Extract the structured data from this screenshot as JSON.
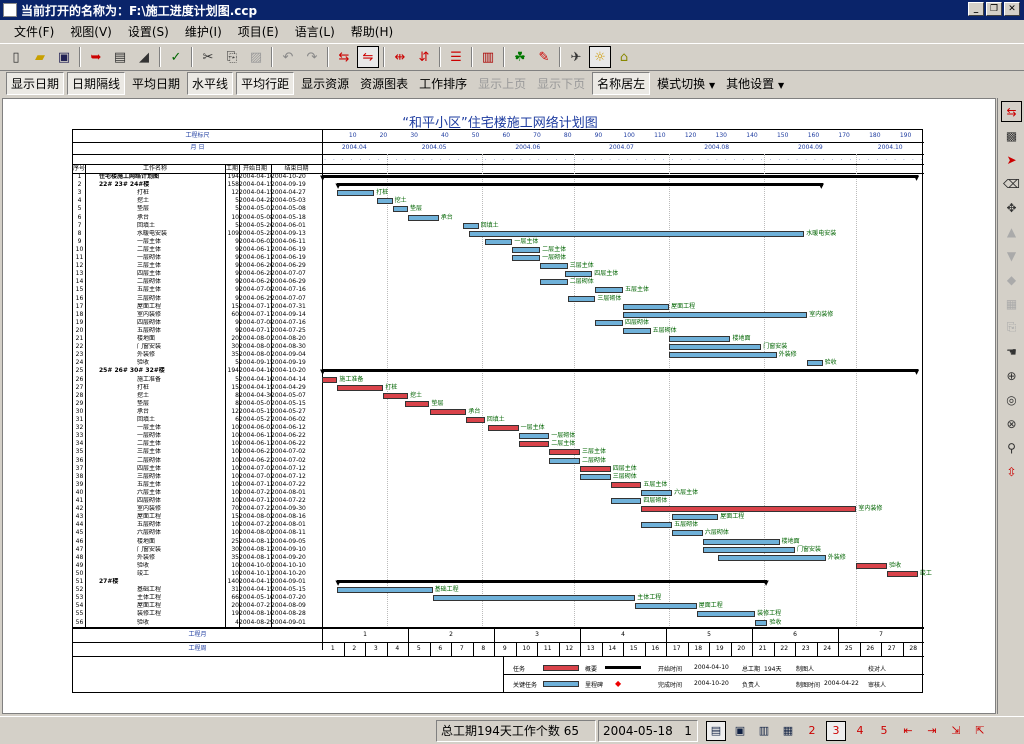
{
  "window": {
    "title": "当前打开的名称为：F:\\施工进度计划图.ccp",
    "buttons": [
      "0",
      "1",
      "r"
    ]
  },
  "menu": [
    "文件(F)",
    "视图(V)",
    "设置(S)",
    "维护(I)",
    "项目(E)",
    "语言(L)",
    "帮助(H)"
  ],
  "toolbar1": {
    "icons": [
      "new-icon",
      "open-icon",
      "save-icon",
      "import-icon",
      "export-icon",
      "fill-icon",
      "check-icon",
      "cut-icon",
      "copy-icon",
      "paste-icon",
      "undo-icon",
      "redo-icon",
      "link-icon",
      "link-active-icon",
      "arrow-left-right-icon",
      "arrow-up-down-icon",
      "align-icon",
      "books-icon",
      "people-icon",
      "pencil-icon",
      "plane-icon",
      "bulb-icon",
      "fold-icon"
    ]
  },
  "toolbar2": [
    {
      "label": "显示日期",
      "state": "pressed"
    },
    {
      "label": "日期隔线",
      "state": "pressed"
    },
    {
      "label": "平均日期",
      "state": "normal"
    },
    {
      "label": "水平线",
      "state": "pressed"
    },
    {
      "label": "平均行距",
      "state": "pressed"
    },
    {
      "label": "显示资源",
      "state": "normal"
    },
    {
      "label": "资源图表",
      "state": "normal"
    },
    {
      "label": "工作排序",
      "state": "normal"
    },
    {
      "label": "显示上页",
      "state": "disabled"
    },
    {
      "label": "显示下页",
      "state": "disabled"
    },
    {
      "label": "名称居左",
      "state": "pressed"
    },
    {
      "label": "模式切换",
      "state": "dropdown"
    },
    {
      "label": "其他设置",
      "state": "dropdown"
    }
  ],
  "chart": {
    "title": "“和平小区”住宅楼施工网络计划图",
    "hdr_work_scale": "工程标尺",
    "hdr_month": "月 日",
    "col_headers": [
      "序号",
      "工作名称",
      "工期",
      "开始日期",
      "结束日期"
    ],
    "scale_ticks": [
      "10",
      "20",
      "30",
      "40",
      "50",
      "60",
      "70",
      "80",
      "90",
      "100",
      "110",
      "120",
      "130",
      "140",
      "150",
      "160",
      "170",
      "180",
      "190"
    ],
    "months": [
      "2004.04",
      "2004.05",
      "2004.06",
      "2004.07",
      "2004.08",
      "2004.09",
      "2004.10"
    ],
    "bottom_week_label": "工程月",
    "bottom_week": [
      "1",
      "2",
      "3",
      "4",
      "5",
      "6",
      "7"
    ],
    "bottom_weeknum_label": "工程周",
    "bottom_weeknums": [
      "1",
      "2",
      "3",
      "4",
      "5",
      "6",
      "7",
      "8",
      "9",
      "10",
      "11",
      "12",
      "13",
      "14",
      "15",
      "16",
      "17",
      "18",
      "19",
      "20",
      "21",
      "22",
      "23",
      "24",
      "25",
      "26",
      "27",
      "28"
    ],
    "tasks": [
      {
        "n": "1",
        "name": "住宅楼施工网络计划图",
        "d": "194",
        "s": "2004-04-10",
        "e": "2004-10-20",
        "type": "sum",
        "b": 0,
        "l": 194,
        "label": ""
      },
      {
        "n": "2",
        "name": "22# 23# 24#楼",
        "d": "158",
        "s": "2004-04-15",
        "e": "2004-09-19",
        "type": "sum",
        "b": 5,
        "l": 158,
        "label": ""
      },
      {
        "n": "3",
        "name": "打桩",
        "d": "12",
        "s": "2004-04-15",
        "e": "2004-04-27",
        "type": "blue",
        "b": 5,
        "l": 12,
        "label": "打桩"
      },
      {
        "n": "4",
        "name": "挖土",
        "d": "5",
        "s": "2004-04-28",
        "e": "2004-05-03",
        "type": "blue",
        "b": 18,
        "l": 5,
        "label": "挖土"
      },
      {
        "n": "5",
        "name": "垫层",
        "d": "5",
        "s": "2004-05-03",
        "e": "2004-05-08",
        "type": "blue",
        "b": 23,
        "l": 5,
        "label": "垫层"
      },
      {
        "n": "6",
        "name": "承台",
        "d": "10",
        "s": "2004-05-08",
        "e": "2004-05-18",
        "type": "blue",
        "b": 28,
        "l": 10,
        "label": "承台"
      },
      {
        "n": "7",
        "name": "回填土",
        "d": "5",
        "s": "2004-05-26",
        "e": "2004-06-01",
        "type": "blue",
        "b": 46,
        "l": 5,
        "label": "回填土"
      },
      {
        "n": "8",
        "name": "水暖电安装",
        "d": "109",
        "s": "2004-05-28",
        "e": "2004-09-13",
        "type": "blue",
        "b": 48,
        "l": 109,
        "label": "水暖电安装"
      },
      {
        "n": "9",
        "name": "一层主体",
        "d": "9",
        "s": "2004-06-02",
        "e": "2004-06-11",
        "type": "blue",
        "b": 53,
        "l": 9,
        "label": "一层主体"
      },
      {
        "n": "10",
        "name": "二层主体",
        "d": "9",
        "s": "2004-06-11",
        "e": "2004-06-19",
        "type": "blue",
        "b": 62,
        "l": 9,
        "label": "二层主体"
      },
      {
        "n": "11",
        "name": "一层砌体",
        "d": "9",
        "s": "2004-06-11",
        "e": "2004-06-19",
        "type": "blue",
        "b": 62,
        "l": 9,
        "label": "一层砌体"
      },
      {
        "n": "12",
        "name": "三层主体",
        "d": "9",
        "s": "2004-06-20",
        "e": "2004-06-29",
        "type": "blue",
        "b": 71,
        "l": 9,
        "label": "三层主体"
      },
      {
        "n": "13",
        "name": "四层主体",
        "d": "9",
        "s": "2004-06-28",
        "e": "2004-07-07",
        "type": "blue",
        "b": 79,
        "l": 9,
        "label": "四层主体"
      },
      {
        "n": "14",
        "name": "二层砌体",
        "d": "9",
        "s": "2004-06-20",
        "e": "2004-06-29",
        "type": "blue",
        "b": 71,
        "l": 9,
        "label": "二层砌体"
      },
      {
        "n": "15",
        "name": "五层主体",
        "d": "9",
        "s": "2004-07-08",
        "e": "2004-07-16",
        "type": "blue",
        "b": 89,
        "l": 9,
        "label": "五层主体"
      },
      {
        "n": "16",
        "name": "三层砌体",
        "d": "9",
        "s": "2004-06-29",
        "e": "2004-07-07",
        "type": "blue",
        "b": 80,
        "l": 9,
        "label": "三层砌体"
      },
      {
        "n": "17",
        "name": "屋面工程",
        "d": "15",
        "s": "2004-07-17",
        "e": "2004-07-31",
        "type": "blue",
        "b": 98,
        "l": 15,
        "label": "屋面工程"
      },
      {
        "n": "18",
        "name": "室内装修",
        "d": "60",
        "s": "2004-07-17",
        "e": "2004-09-14",
        "type": "blue",
        "b": 98,
        "l": 60,
        "label": "室内装修"
      },
      {
        "n": "19",
        "name": "四层砌体",
        "d": "9",
        "s": "2004-07-08",
        "e": "2004-07-16",
        "type": "blue",
        "b": 89,
        "l": 9,
        "label": "四层砌体"
      },
      {
        "n": "20",
        "name": "五层砌体",
        "d": "9",
        "s": "2004-07-17",
        "e": "2004-07-25",
        "type": "blue",
        "b": 98,
        "l": 9,
        "label": "五层砌体"
      },
      {
        "n": "21",
        "name": "楼地面",
        "d": "20",
        "s": "2004-08-01",
        "e": "2004-08-20",
        "type": "blue",
        "b": 113,
        "l": 20,
        "label": "楼地面"
      },
      {
        "n": "22",
        "name": "门窗安装",
        "d": "30",
        "s": "2004-08-01",
        "e": "2004-08-30",
        "type": "blue",
        "b": 113,
        "l": 30,
        "label": "门窗安装"
      },
      {
        "n": "23",
        "name": "外装修",
        "d": "35",
        "s": "2004-08-01",
        "e": "2004-09-04",
        "type": "blue",
        "b": 113,
        "l": 35,
        "label": "外装修"
      },
      {
        "n": "24",
        "name": "验收",
        "d": "5",
        "s": "2004-09-15",
        "e": "2004-09-19",
        "type": "blue",
        "b": 158,
        "l": 5,
        "label": "验收"
      },
      {
        "n": "25",
        "name": "25# 26# 30# 32#楼",
        "d": "194",
        "s": "2004-04-10",
        "e": "2004-10-20",
        "type": "sum",
        "b": 0,
        "l": 194,
        "label": ""
      },
      {
        "n": "26",
        "name": "施工准备",
        "d": "5",
        "s": "2004-04-10",
        "e": "2004-04-14",
        "type": "red",
        "b": 0,
        "l": 5,
        "label": "施工准备"
      },
      {
        "n": "27",
        "name": "打桩",
        "d": "15",
        "s": "2004-04-15",
        "e": "2004-04-29",
        "type": "red",
        "b": 5,
        "l": 15,
        "label": "打桩"
      },
      {
        "n": "28",
        "name": "挖土",
        "d": "8",
        "s": "2004-04-30",
        "e": "2004-05-07",
        "type": "red",
        "b": 20,
        "l": 8,
        "label": "挖土"
      },
      {
        "n": "29",
        "name": "垫层",
        "d": "8",
        "s": "2004-05-07",
        "e": "2004-05-15",
        "type": "red",
        "b": 27,
        "l": 8,
        "label": "垫层"
      },
      {
        "n": "30",
        "name": "承台",
        "d": "12",
        "s": "2004-05-15",
        "e": "2004-05-27",
        "type": "red",
        "b": 35,
        "l": 12,
        "label": "承台"
      },
      {
        "n": "31",
        "name": "回填土",
        "d": "6",
        "s": "2004-05-27",
        "e": "2004-06-02",
        "type": "red",
        "b": 47,
        "l": 6,
        "label": "回填土"
      },
      {
        "n": "32",
        "name": "一层主体",
        "d": "10",
        "s": "2004-06-03",
        "e": "2004-06-12",
        "type": "red",
        "b": 54,
        "l": 10,
        "label": "一层主体"
      },
      {
        "n": "33",
        "name": "一层砌体",
        "d": "10",
        "s": "2004-06-13",
        "e": "2004-06-22",
        "type": "blue",
        "b": 64,
        "l": 10,
        "label": "一层砌体"
      },
      {
        "n": "34",
        "name": "二层主体",
        "d": "10",
        "s": "2004-06-13",
        "e": "2004-06-22",
        "type": "red",
        "b": 64,
        "l": 10,
        "label": "二层主体"
      },
      {
        "n": "35",
        "name": "三层主体",
        "d": "10",
        "s": "2004-06-23",
        "e": "2004-07-02",
        "type": "red",
        "b": 74,
        "l": 10,
        "label": "三层主体"
      },
      {
        "n": "36",
        "name": "二层砌体",
        "d": "10",
        "s": "2004-06-23",
        "e": "2004-07-02",
        "type": "blue",
        "b": 74,
        "l": 10,
        "label": "二层砌体"
      },
      {
        "n": "37",
        "name": "四层主体",
        "d": "10",
        "s": "2004-07-03",
        "e": "2004-07-12",
        "type": "red",
        "b": 84,
        "l": 10,
        "label": "四层主体"
      },
      {
        "n": "38",
        "name": "三层砌体",
        "d": "10",
        "s": "2004-07-03",
        "e": "2004-07-12",
        "type": "blue",
        "b": 84,
        "l": 10,
        "label": "三层砌体"
      },
      {
        "n": "39",
        "name": "五层主体",
        "d": "10",
        "s": "2004-07-13",
        "e": "2004-07-22",
        "type": "red",
        "b": 94,
        "l": 10,
        "label": "五层主体"
      },
      {
        "n": "40",
        "name": "六层主体",
        "d": "10",
        "s": "2004-07-23",
        "e": "2004-08-01",
        "type": "blue",
        "b": 104,
        "l": 10,
        "label": "六层主体"
      },
      {
        "n": "41",
        "name": "四层砌体",
        "d": "10",
        "s": "2004-07-13",
        "e": "2004-07-22",
        "type": "blue",
        "b": 94,
        "l": 10,
        "label": "四层砌体"
      },
      {
        "n": "42",
        "name": "室内装修",
        "d": "70",
        "s": "2004-07-23",
        "e": "2004-09-30",
        "type": "red",
        "b": 104,
        "l": 70,
        "label": "室内装修"
      },
      {
        "n": "43",
        "name": "屋面工程",
        "d": "15",
        "s": "2004-08-02",
        "e": "2004-08-16",
        "type": "blue",
        "b": 114,
        "l": 15,
        "label": "屋面工程"
      },
      {
        "n": "44",
        "name": "五层砌体",
        "d": "10",
        "s": "2004-07-23",
        "e": "2004-08-01",
        "type": "blue",
        "b": 104,
        "l": 10,
        "label": "五层砌体"
      },
      {
        "n": "45",
        "name": "六层砌体",
        "d": "10",
        "s": "2004-08-02",
        "e": "2004-08-11",
        "type": "blue",
        "b": 114,
        "l": 10,
        "label": "六层砌体"
      },
      {
        "n": "46",
        "name": "楼地面",
        "d": "25",
        "s": "2004-08-12",
        "e": "2004-09-05",
        "type": "blue",
        "b": 124,
        "l": 25,
        "label": "楼地面"
      },
      {
        "n": "47",
        "name": "门窗安装",
        "d": "30",
        "s": "2004-08-12",
        "e": "2004-09-10",
        "type": "blue",
        "b": 124,
        "l": 30,
        "label": "门窗安装"
      },
      {
        "n": "48",
        "name": "外装修",
        "d": "35",
        "s": "2004-08-17",
        "e": "2004-09-20",
        "type": "blue",
        "b": 129,
        "l": 35,
        "label": "外装修"
      },
      {
        "n": "49",
        "name": "验收",
        "d": "10",
        "s": "2004-10-01",
        "e": "2004-10-10",
        "type": "red",
        "b": 174,
        "l": 10,
        "label": "验收"
      },
      {
        "n": "50",
        "name": "竣工",
        "d": "10",
        "s": "2004-10-11",
        "e": "2004-10-20",
        "type": "red",
        "b": 184,
        "l": 10,
        "label": "竣工"
      },
      {
        "n": "51",
        "name": "27#楼",
        "d": "140",
        "s": "2004-04-15",
        "e": "2004-09-01",
        "type": "sum",
        "b": 5,
        "l": 140,
        "label": ""
      },
      {
        "n": "52",
        "name": "基础工程",
        "d": "31",
        "s": "2004-04-15",
        "e": "2004-05-15",
        "type": "blue",
        "b": 5,
        "l": 31,
        "label": "基础工程"
      },
      {
        "n": "53",
        "name": "主体工程",
        "d": "66",
        "s": "2004-05-16",
        "e": "2004-07-20",
        "type": "blue",
        "b": 36,
        "l": 66,
        "label": "主体工程"
      },
      {
        "n": "54",
        "name": "屋面工程",
        "d": "20",
        "s": "2004-07-21",
        "e": "2004-08-09",
        "type": "blue",
        "b": 102,
        "l": 20,
        "label": "屋面工程"
      },
      {
        "n": "55",
        "name": "装修工程",
        "d": "19",
        "s": "2004-08-10",
        "e": "2004-08-28",
        "type": "blue",
        "b": 122,
        "l": 19,
        "label": "装修工程"
      },
      {
        "n": "56",
        "name": "验收",
        "d": "4",
        "s": "2004-08-29",
        "e": "2004-09-01",
        "type": "blue",
        "b": 141,
        "l": 4,
        "label": "验收"
      }
    ],
    "legend": {
      "task": "任务",
      "key_task": "关键任务",
      "sum": "概要",
      "milestone": "里程碑",
      "plan_start": "开始时间",
      "plan_start_val": "2004-04-10",
      "total": "总工期",
      "total_val": "194天",
      "compiler": "制图人",
      "checker": "校对人",
      "plan_end": "完成时间",
      "plan_end_val": "2004-10-20",
      "manager": "负责人",
      "date_label": "制图时间",
      "date_val": "2004-04-22",
      "reviewer": "审核人"
    }
  },
  "right_toolbar": [
    "add-link-icon",
    "palette-icon",
    "select-arrow-icon",
    "eraser-icon",
    "move-icon",
    "up-icon",
    "down-icon",
    "diamond-icon",
    "grid-icon",
    "copy2-icon",
    "hand-icon",
    "zoom-icon",
    "circle-icon",
    "target-icon",
    "search-icon",
    "split-icon"
  ],
  "status": {
    "summary": "总工期194天工作个数 65",
    "date": "2004-05-18",
    "page": "1",
    "icons": [
      "view1-icon",
      "view2-icon",
      "view3-icon",
      "view4-icon",
      "n2-icon",
      "n3-icon",
      "n4-icon",
      "n5-icon",
      "n6-icon",
      "n7-icon",
      "n8-icon",
      "n9-icon"
    ]
  }
}
